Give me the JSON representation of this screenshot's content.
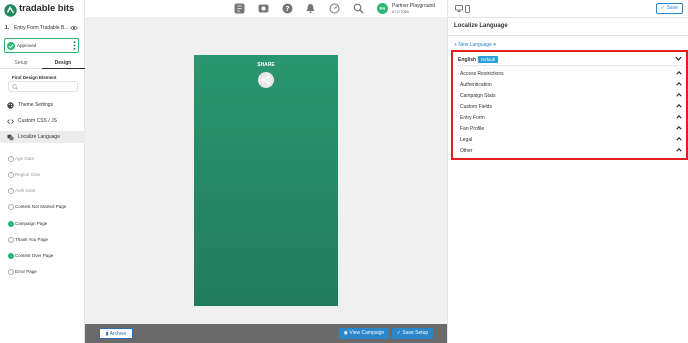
{
  "app": {
    "logo_text": "tradable bits"
  },
  "sidebar": {
    "step_number": "1.",
    "entry_title": "Entry Form Tradable B...",
    "status_label": "Approved",
    "tabs": [
      {
        "label": "Setup"
      },
      {
        "label": "Design"
      }
    ],
    "find_label": "Find Design Element",
    "menu": [
      {
        "label": "Theme Settings"
      },
      {
        "label": "Custom CSS / JS"
      },
      {
        "label": "Localize Language"
      }
    ],
    "pages": [
      {
        "label": "Age Gate"
      },
      {
        "label": "Region Gate"
      },
      {
        "label": "Auth Gate"
      },
      {
        "label": "Contest Not Started Page"
      },
      {
        "label": "Campaign Page"
      },
      {
        "label": "Thank You Page"
      },
      {
        "label": "Contest Over Page"
      },
      {
        "label": "Error Page"
      }
    ]
  },
  "topbar": {
    "avatar_initials": "PA",
    "account_name": "Partner Playground",
    "account_id": "#7177060"
  },
  "canvas": {
    "share_label": "SHARE"
  },
  "bottombar": {
    "archive_label": "Archive",
    "view_label": "View Campaign",
    "save_setup_label": "Save Setup"
  },
  "rightpanel": {
    "save_label": "Save",
    "title": "Localize Language",
    "new_language_label": "New Language",
    "language": "English",
    "default_badge": "Default",
    "categories": [
      {
        "label": "Access Restrictions"
      },
      {
        "label": "Authentication"
      },
      {
        "label": "Campaign Stats"
      },
      {
        "label": "Custom Fields"
      },
      {
        "label": "Entry Form"
      },
      {
        "label": "Fan Profile"
      },
      {
        "label": "Legal"
      },
      {
        "label": "Other"
      }
    ]
  },
  "colors": {
    "brand_green": "#2bb673",
    "phone_green": "#227b5d",
    "accent_blue": "#2a86c8",
    "highlight_red": "#e02020"
  }
}
